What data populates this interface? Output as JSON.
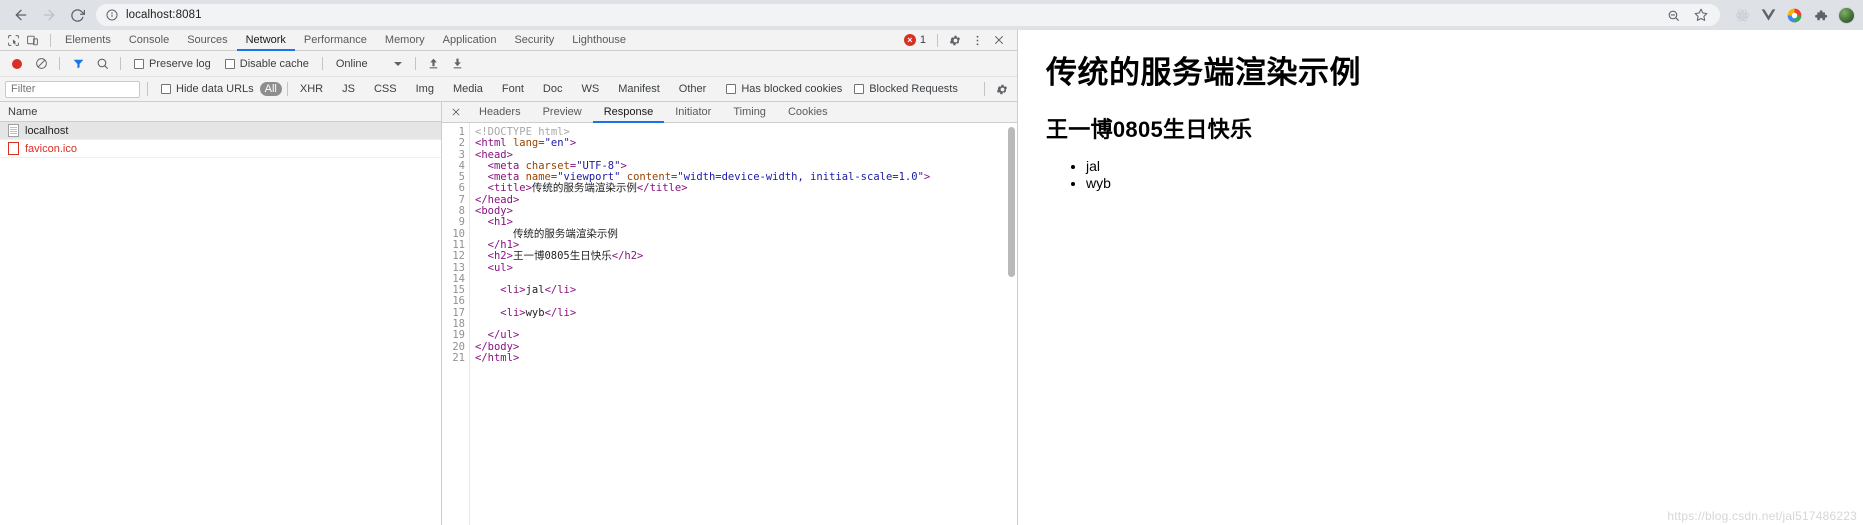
{
  "browser": {
    "back_icon": "back-arrow-icon",
    "forward_icon": "forward-arrow-icon",
    "reload_icon": "reload-icon",
    "info_icon": "site-info-icon",
    "url": "localhost:8081",
    "zoom_icon": "zoom-out-icon",
    "bookmark_icon": "star-icon",
    "extensions": [
      "react-devtools-icon",
      "vue-devtools-icon",
      "color-circle-icon",
      "puzzle-piece-icon"
    ],
    "avatar": "profile-avatar"
  },
  "devtools": {
    "panel_icons": [
      "inspect-element-icon",
      "device-toolbar-icon"
    ],
    "tabs": [
      {
        "label": "Elements",
        "active": false
      },
      {
        "label": "Console",
        "active": false
      },
      {
        "label": "Sources",
        "active": false
      },
      {
        "label": "Network",
        "active": true
      },
      {
        "label": "Performance",
        "active": false
      },
      {
        "label": "Memory",
        "active": false
      },
      {
        "label": "Application",
        "active": false
      },
      {
        "label": "Security",
        "active": false
      },
      {
        "label": "Lighthouse",
        "active": false
      }
    ],
    "error_count": "1",
    "settings_icon": "gear-icon",
    "more_icon": "kebab-menu-icon",
    "close_icon": "close-icon",
    "network_toolbar": {
      "record_icon": "record-button",
      "clear_icon": "clear-icon",
      "filter_icon": "filter-funnel-icon",
      "search_icon": "search-icon",
      "preserve_log": "Preserve log",
      "disable_cache": "Disable cache",
      "throttling": "Online",
      "import_icon": "import-har-icon",
      "export_icon": "export-har-icon"
    },
    "filter_bar": {
      "filter_placeholder": "Filter",
      "filter_value": "",
      "hide_data_urls": "Hide data URLs",
      "types": [
        "All",
        "XHR",
        "JS",
        "CSS",
        "Img",
        "Media",
        "Font",
        "Doc",
        "WS",
        "Manifest",
        "Other"
      ],
      "active_type": "All",
      "has_blocked_cookies": "Has blocked cookies",
      "blocked_requests": "Blocked Requests",
      "settings_icon": "filter-settings-gear-icon"
    },
    "request_list": {
      "column_header": "Name",
      "rows": [
        {
          "name": "localhost",
          "icon": "document-icon",
          "selected": true,
          "error": false
        },
        {
          "name": "favicon.ico",
          "icon": "blank-file-icon",
          "selected": false,
          "error": true
        }
      ]
    },
    "detail_tabs": [
      {
        "label": "Headers",
        "active": false
      },
      {
        "label": "Preview",
        "active": false
      },
      {
        "label": "Response",
        "active": true
      },
      {
        "label": "Initiator",
        "active": false
      },
      {
        "label": "Timing",
        "active": false
      },
      {
        "label": "Cookies",
        "active": false
      }
    ],
    "detail_close_icon": "close-detail-icon",
    "response_code": {
      "line_numbers": [
        "1",
        "2",
        "3",
        "4",
        "5",
        "6",
        "7",
        "8",
        "9",
        "10",
        "11",
        "12",
        "13",
        "14",
        "15",
        "16",
        "17",
        "18",
        "19",
        "20",
        "21"
      ],
      "lines": [
        "<!DOCTYPE html>",
        "<html lang=\"en\">",
        "<head>",
        "  <meta charset=\"UTF-8\">",
        "  <meta name=\"viewport\" content=\"width=device-width, initial-scale=1.0\">",
        "  <title>传统的服务端渲染示例</title>",
        "</head>",
        "<body>",
        "  <h1>",
        "      传统的服务端渲染示例",
        "  </h1>",
        "  <h2>王一博0805生日快乐</h2>",
        "  <ul>",
        "",
        "    <li>jal</li>",
        "",
        "    <li>wyb</li>",
        "",
        "  </ul>",
        "</body>",
        "</html>"
      ]
    }
  },
  "rendered_page": {
    "h1": "传统的服务端渲染示例",
    "h2": "王一博0805生日快乐",
    "list_items": [
      "jal",
      "wyb"
    ],
    "watermark": "https://blog.csdn.net/jal517486223"
  }
}
